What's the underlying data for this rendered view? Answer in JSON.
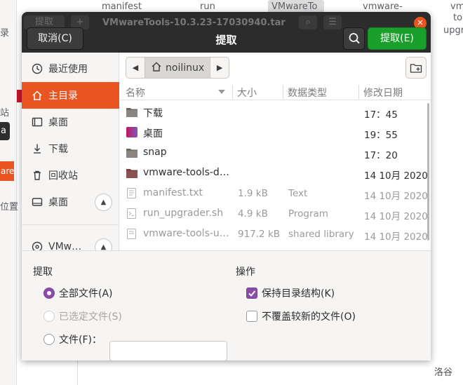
{
  "background": {
    "left_fragments": [
      "录",
      "站",
      "a",
      "are T",
      "位置"
    ],
    "top_files": [
      "manifest",
      "run",
      "VMwareTo",
      "vmware-"
    ],
    "right_fragments": [
      "vm",
      "to",
      "upgr"
    ],
    "watermark": "洛谷"
  },
  "dialog": {
    "title": "提取",
    "ghost_title": "VMwareTools-10.3.23-17030940.tar",
    "ghost_extract": "提取",
    "ghost_plus": "+",
    "cancel_label": "取消(C)",
    "extract_label": "提取(E)",
    "accent": "#e95420",
    "extract_color": "#1b9f2c"
  },
  "sidebar": {
    "items": [
      {
        "label": "最近使用",
        "icon": "recent-icon"
      },
      {
        "label": "主目录",
        "icon": "home-icon",
        "active": true
      },
      {
        "label": "桌面",
        "icon": "desktop-icon"
      },
      {
        "label": "下载",
        "icon": "download-icon"
      },
      {
        "label": "回收站",
        "icon": "trash-icon"
      },
      {
        "label": "桌面",
        "icon": "drive-icon"
      },
      {
        "label": "VMw…",
        "icon": "disc-icon"
      }
    ]
  },
  "pathbar": {
    "crumb": "noilinux"
  },
  "columns": {
    "name": "名称",
    "size": "大小",
    "type": "数据类型",
    "modified": "修改日期"
  },
  "files": [
    {
      "name": "下载",
      "size": "",
      "type": "",
      "modified": "17：45",
      "icon": "folder-icon"
    },
    {
      "name": "桌面",
      "size": "",
      "type": "",
      "modified": "19：55",
      "icon": "desktop-folder-icon"
    },
    {
      "name": "snap",
      "size": "",
      "type": "",
      "modified": "17：20",
      "icon": "folder-icon"
    },
    {
      "name": "vmware-tools-di…",
      "size": "",
      "type": "",
      "modified": "14 10月 2020",
      "icon": "folder-icon"
    },
    {
      "name": "manifest.txt",
      "size": "1.9 kB",
      "type": "Text",
      "modified": "14 10月 2020",
      "icon": "text-file-icon"
    },
    {
      "name": "run_upgrader.sh",
      "size": "4.9 kB",
      "type": "Program",
      "modified": "14 10月 2020",
      "icon": "script-file-icon"
    },
    {
      "name": "vmware-tools-u…",
      "size": "917.2 kB",
      "type": "shared library",
      "modified": "14 10月 2020",
      "icon": "library-file-icon"
    }
  ],
  "options": {
    "extract_heading": "提取",
    "actions_heading": "操作",
    "all_files": "全部文件(A)",
    "selected_files": "已选定文件(S)",
    "files_label": "文件(F)：",
    "files_value": "",
    "keep_structure": "保持目录结构(K)",
    "no_overwrite_newer": "不覆盖较新的文件(O)"
  }
}
